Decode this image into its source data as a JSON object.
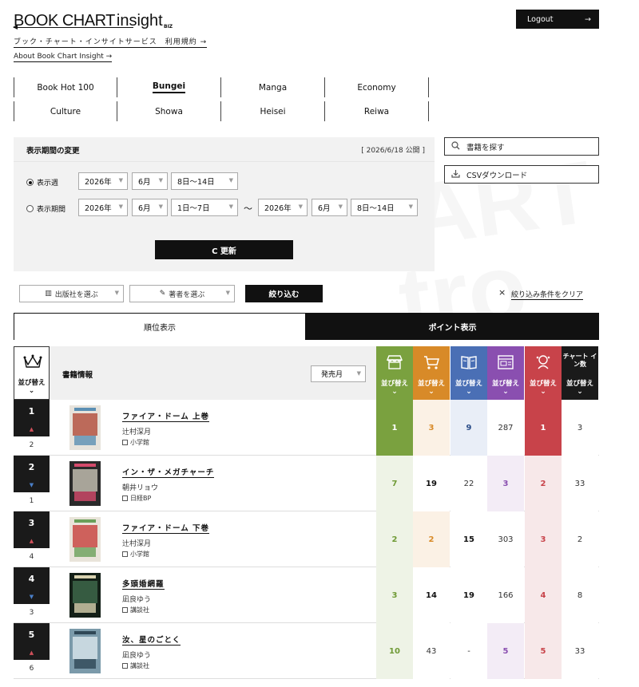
{
  "header": {
    "logo_a": "BOOK CHART",
    "logo_b": "insight",
    "logo_biz": "BIZ",
    "sub_link1": "ブック・チャート・インサイトサービス　利用規約 →",
    "sub_link2": "About Book Chart Insight →",
    "logout_label": "Logout",
    "logout_arrow": "→"
  },
  "nav": {
    "row1": [
      "Book Hot 100",
      "Bungei",
      "Manga",
      "Economy"
    ],
    "row2": [
      "Culture",
      "Showa",
      "Heisei",
      "Reiwa"
    ],
    "active": "Bungei"
  },
  "period": {
    "title": "表示期間の変更",
    "published": "[ 2026/6/18 公開 ]",
    "week_label": "表示週",
    "range_label": "表示期間",
    "week": {
      "year": "2026年",
      "month": "6月",
      "day": "8日〜14日"
    },
    "range_from": {
      "year": "2026年",
      "month": "6月",
      "day": "1日〜7日"
    },
    "tilde": "〜",
    "range_to": {
      "year": "2026年",
      "month": "6月",
      "day": "8日〜14日"
    },
    "update_label": "C 更新"
  },
  "side": {
    "search_label": "書籍を探す",
    "csv_label": "CSVダウンロード"
  },
  "filters": {
    "publisher": "出版社を選ぶ",
    "author": "著者を選ぶ",
    "apply": "絞り込む",
    "clear": "絞り込み条件をクリア",
    "clear_icon": "×"
  },
  "tabs": {
    "rank": "順位表示",
    "point": "ポイント表示"
  },
  "table": {
    "sort_label": "並び替え",
    "info_header": "書籍情報",
    "month_select": "発売月",
    "chart_count_title": "チャート イン数",
    "columns": [
      {
        "icon": "store-icon",
        "color": "#7aa13f",
        "tint": "#8aab55"
      },
      {
        "icon": "cart-icon",
        "color": "#d88a28",
        "tint": "#fbf1e5"
      },
      {
        "icon": "ebook-icon",
        "color": "#4a6fb5",
        "tint": "#e9eef7"
      },
      {
        "icon": "web-icon",
        "color": "#8a4fb0",
        "tint": "#f3ecf6"
      },
      {
        "icon": "buzz-icon",
        "color": "#c8434a",
        "tint": "#f7e8e9"
      },
      {
        "icon": "chart-icon",
        "color": "#1a1a1a",
        "tint": "#ffffff"
      }
    ],
    "rows": [
      {
        "rank": "1",
        "move": "up",
        "prev": "2",
        "title": "ファイア・ドーム 上巻",
        "author": "辻村深月",
        "publisher": "小学館",
        "vals": [
          "1",
          "3",
          "9",
          "287",
          "1",
          "3"
        ],
        "cover": "c1"
      },
      {
        "rank": "2",
        "move": "down",
        "prev": "1",
        "title": "イン・ザ・メガチャーチ",
        "author": "朝井リョウ",
        "publisher": "日経BP",
        "vals": [
          "7",
          "19",
          "22",
          "3",
          "2",
          "33"
        ],
        "cover": "c2"
      },
      {
        "rank": "3",
        "move": "up",
        "prev": "4",
        "title": "ファイア・ドーム 下巻",
        "author": "辻村深月",
        "publisher": "小学館",
        "vals": [
          "2",
          "2",
          "15",
          "303",
          "3",
          "2"
        ],
        "cover": "c3"
      },
      {
        "rank": "4",
        "move": "down",
        "prev": "3",
        "title": "多頭婚網羅",
        "author": "凪良ゆう",
        "publisher": "講談社",
        "vals": [
          "3",
          "14",
          "19",
          "166",
          "4",
          "8"
        ],
        "cover": "c4"
      },
      {
        "rank": "5",
        "move": "up",
        "prev": "6",
        "title": "汝、星のごとく",
        "author": "凪良ゆう",
        "publisher": "講談社",
        "vals": [
          "10",
          "43",
          "-",
          "5",
          "5",
          "33"
        ],
        "cover": "c5"
      }
    ]
  }
}
